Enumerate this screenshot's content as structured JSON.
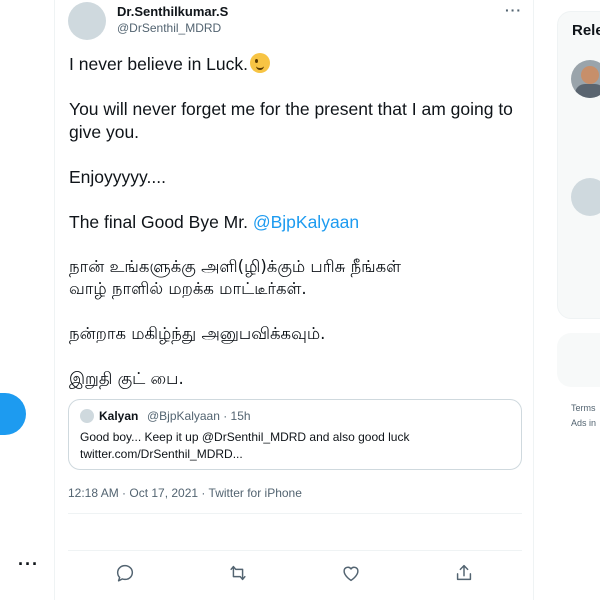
{
  "tweet": {
    "author_name": "Dr.Senthilkumar.S",
    "author_handle": "@DrSenthil_MDRD",
    "more_label": "···",
    "body": {
      "line1": "I never believe in Luck.",
      "emoji": "wink-emoji",
      "para2": "You will never forget me for the present that I am going to give you.",
      "para3": "Enjoyyyyy....",
      "para4_prefix": "The final Good Bye Mr. ",
      "para4_mention": "@BjpKalyaan",
      "tamil1_line1": "நான் உங்களுக்கு அளி(ழி)க்கும் பரிசு நீங்கள்",
      "tamil1_line2": "வாழ் நாளில் மறக்க மாட்டீர்கள்.",
      "tamil2": "நன்றாக மகிழ்ந்து அனுபவிக்கவும்.",
      "tamil3": "இறுதி குட் பை."
    },
    "timestamp": "12:18 AM · Oct 17, 2021 · Twitter for iPhone",
    "quote": {
      "name": "Kalyan",
      "meta": "@BjpKalyaan · 15h",
      "text_line1": "Good boy... Keep it up @DrSenthil_MDRD and also good luck",
      "text_line2": "twitter.com/DrSenthil_MDRD..."
    },
    "actions": [
      "reply-icon",
      "retweet-icon",
      "like-icon",
      "share-icon"
    ]
  },
  "left_rail": {
    "more_label": "···"
  },
  "right_column": {
    "title": "Rele",
    "footer_line1": "Terms",
    "footer_line2": "Ads in"
  },
  "colors": {
    "accent": "#1d9bf0",
    "text": "#0f1419",
    "secondary": "#536471",
    "border": "#cfd9de"
  }
}
